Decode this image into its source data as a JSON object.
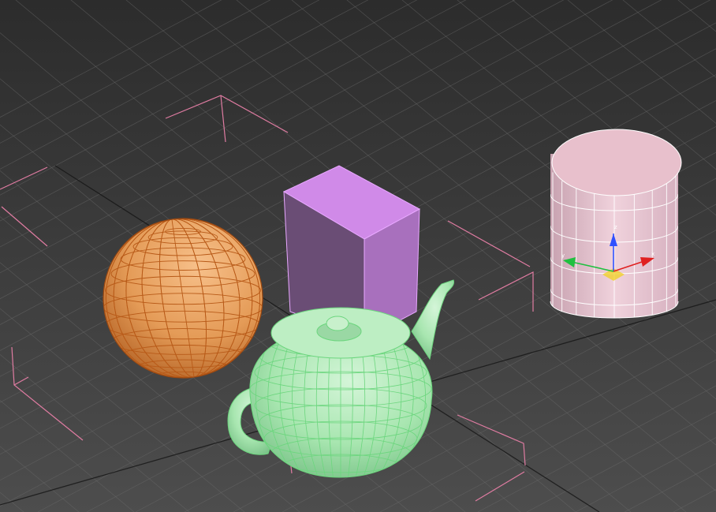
{
  "viewport": {
    "background_top": "#2c2c2c",
    "background_bottom": "#4d4d4d",
    "grid_color": "#6a6a6a",
    "grid_axis_color": "#161616"
  },
  "scene_objects": [
    {
      "name": "sphere",
      "color": "#e49b57",
      "wire_color": "#b85a18"
    },
    {
      "name": "box",
      "color": "#d08ae8",
      "wire_color": "#e8a8ff"
    },
    {
      "name": "cylinder",
      "color": "#e8c8d0",
      "wire_color": "#ffffff"
    },
    {
      "name": "teapot",
      "color": "#a8e6b0",
      "wire_color": "#6cd67e"
    }
  ],
  "selection_bracket_color": "#e07ca2",
  "gizmo": {
    "x_label": "x",
    "y_label": "y",
    "z_label": "z",
    "x_color": "#e02020",
    "y_color": "#20c040",
    "z_color": "#3050ff",
    "plane_color": "#f0d020"
  }
}
